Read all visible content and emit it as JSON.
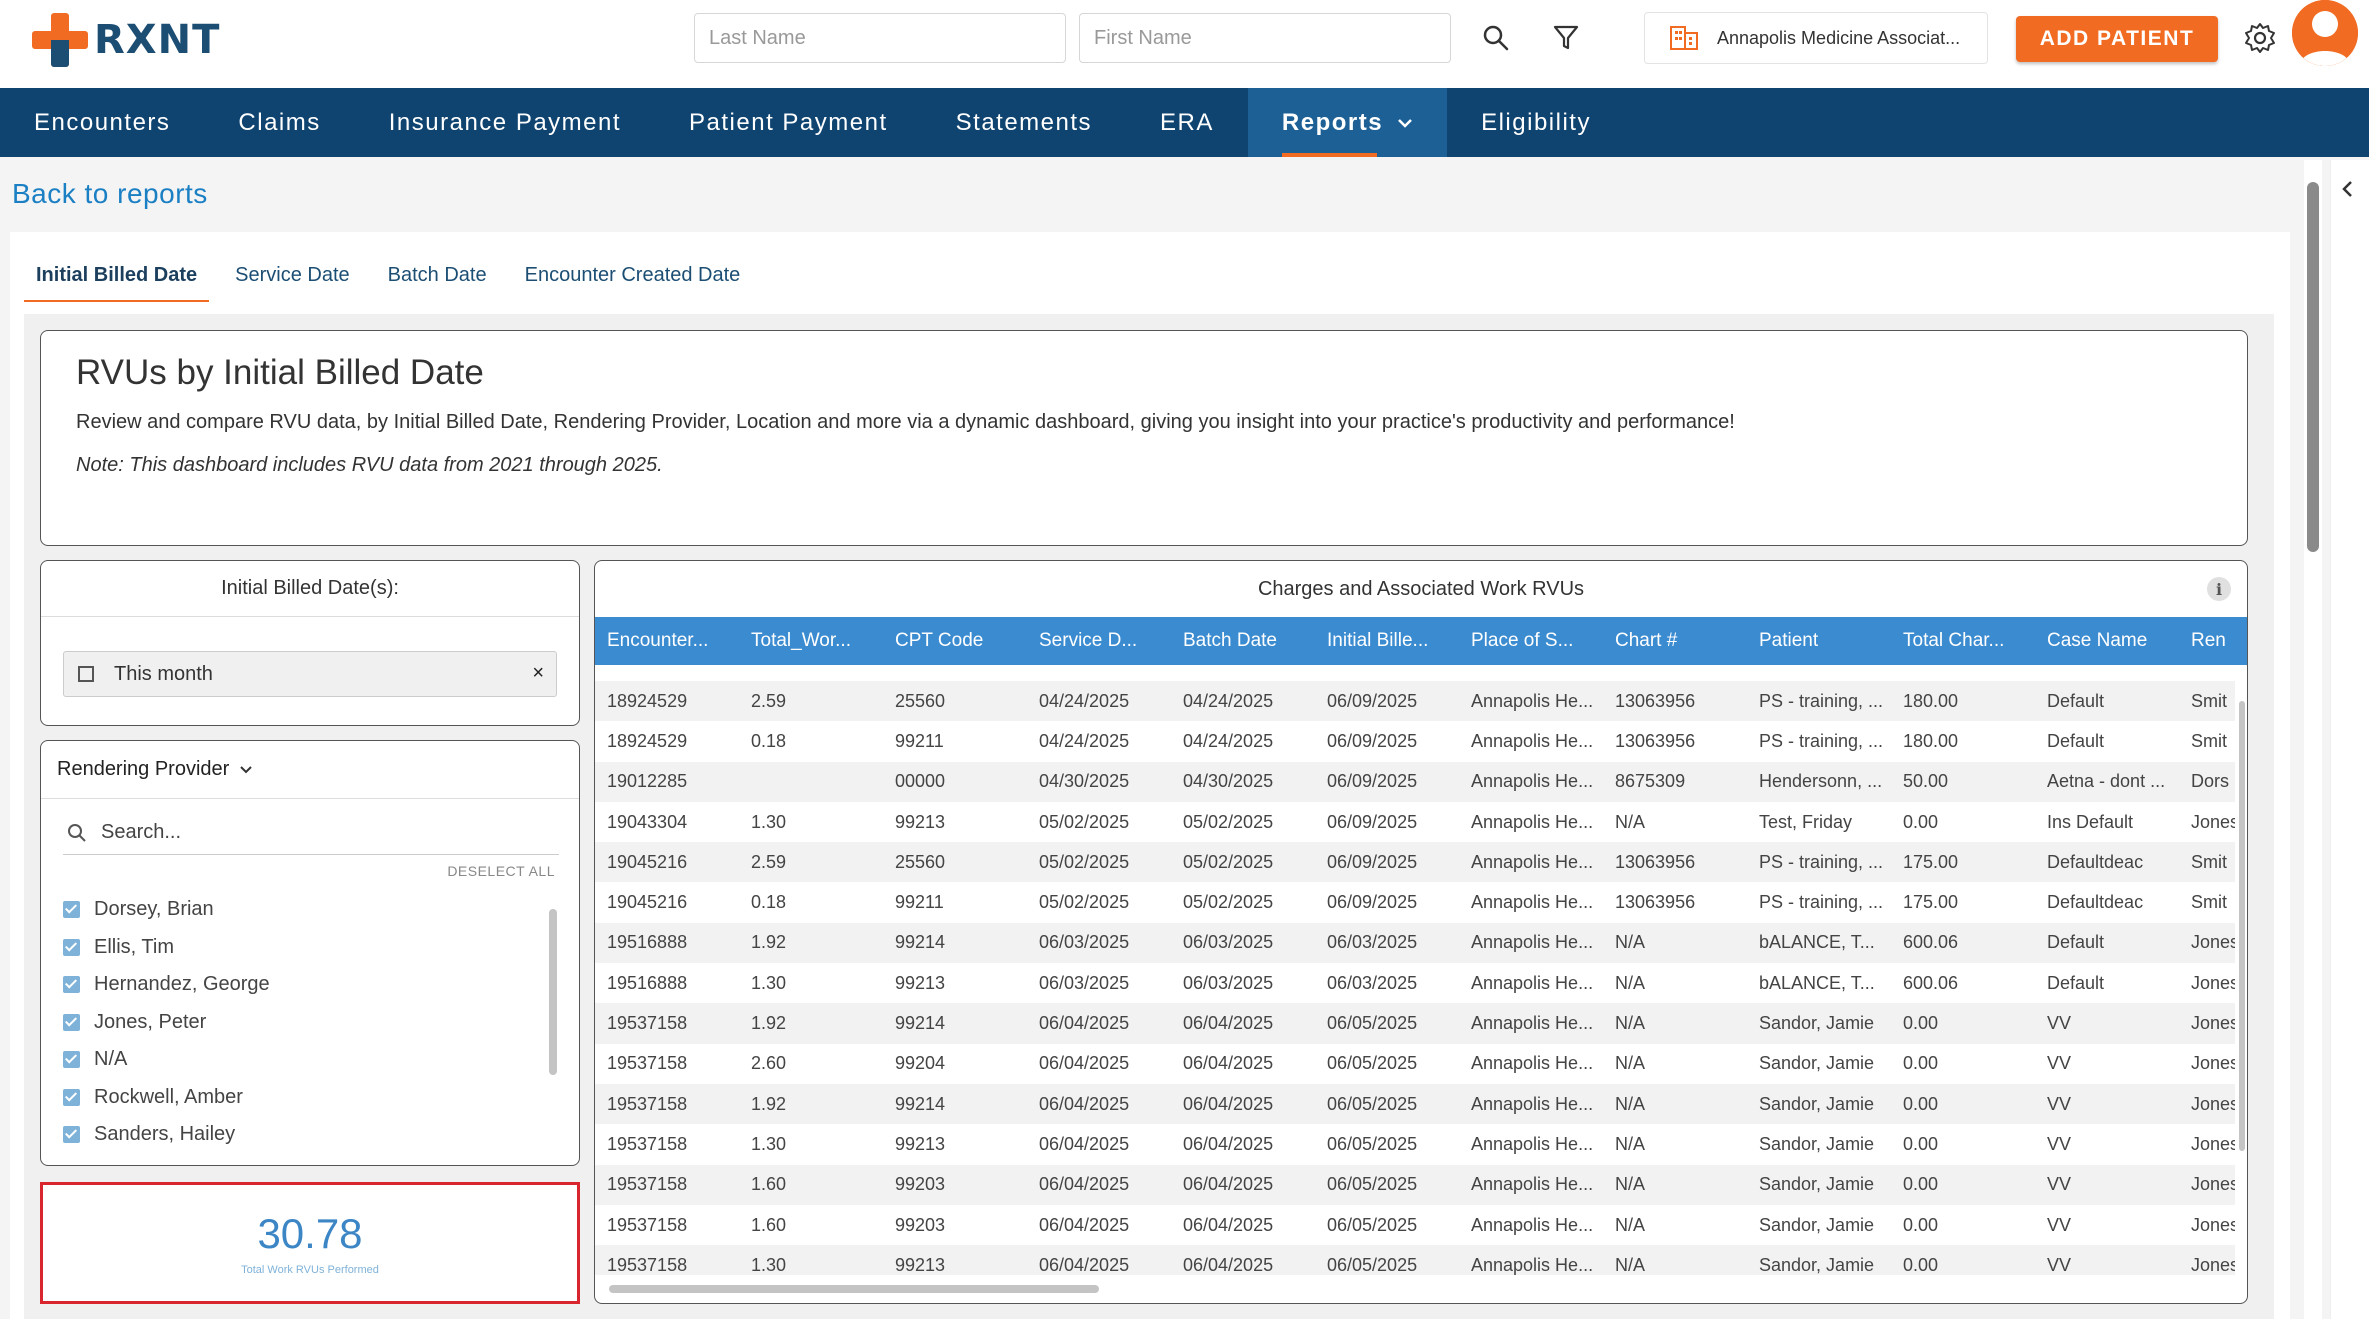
{
  "app": {
    "logo_text": "RXNT",
    "last_name_placeholder": "Last Name",
    "first_name_placeholder": "First Name",
    "practice_name": "Annapolis Medicine Associat...",
    "add_patient_label": "ADD PATIENT"
  },
  "nav": {
    "items": [
      "Encounters",
      "Claims",
      "Insurance Payment",
      "Patient Payment",
      "Statements",
      "ERA",
      "Reports",
      "Eligibility"
    ],
    "active": "Reports"
  },
  "back_label": "Back to reports",
  "tabs": [
    "Initial Billed Date",
    "Service Date",
    "Batch Date",
    "Encounter Created Date"
  ],
  "header": {
    "title": "RVUs by Initial Billed Date",
    "description": "Review and compare RVU data, by Initial Billed Date, Rendering Provider, Location and more via a dynamic dashboard, giving you insight into your practice's productivity and performance!",
    "note": "Note: This dashboard includes RVU data from 2021 through 2025."
  },
  "date_filter": {
    "title": "Initial Billed Date(s):",
    "value": "This month",
    "clear": "×"
  },
  "provider_filter": {
    "title": "Rendering Provider",
    "search_placeholder": "Search...",
    "deselect_label": "DESELECT ALL",
    "providers": [
      "Dorsey, Brian",
      "Ellis, Tim",
      "Hernandez, George",
      "Jones, Peter",
      "N/A",
      "Rockwell, Amber",
      "Sanders, Hailey"
    ]
  },
  "kpi": {
    "value": "30.78",
    "label": "Total Work RVUs Performed"
  },
  "table": {
    "title": "Charges and Associated Work RVUs",
    "info": "i",
    "columns": [
      "Encounter...",
      "Total_Wor...",
      "CPT Code",
      "Service D...",
      "Batch Date",
      "Initial Bille...",
      "Place of S...",
      "Chart #",
      "Patient",
      "Total Char...",
      "Case Name",
      "Ren"
    ],
    "rows": [
      [
        "18924529",
        "2.59",
        "25560",
        "04/24/2025",
        "04/24/2025",
        "06/09/2025",
        "Annapolis He...",
        "13063956",
        "PS - training, ...",
        "180.00",
        "Default",
        "Smit"
      ],
      [
        "18924529",
        "0.18",
        "99211",
        "04/24/2025",
        "04/24/2025",
        "06/09/2025",
        "Annapolis He...",
        "13063956",
        "PS - training, ...",
        "180.00",
        "Default",
        "Smit"
      ],
      [
        "19012285",
        "",
        "00000",
        "04/30/2025",
        "04/30/2025",
        "06/09/2025",
        "Annapolis He...",
        "8675309",
        "Hendersonn, ...",
        "50.00",
        "Aetna - dont ...",
        "Dors"
      ],
      [
        "19043304",
        "1.30",
        "99213",
        "05/02/2025",
        "05/02/2025",
        "06/09/2025",
        "Annapolis He...",
        "N/A",
        "Test, Friday",
        "0.00",
        "Ins Default",
        "Jones"
      ],
      [
        "19045216",
        "2.59",
        "25560",
        "05/02/2025",
        "05/02/2025",
        "06/09/2025",
        "Annapolis He...",
        "13063956",
        "PS - training, ...",
        "175.00",
        "Defaultdeac",
        "Smit"
      ],
      [
        "19045216",
        "0.18",
        "99211",
        "05/02/2025",
        "05/02/2025",
        "06/09/2025",
        "Annapolis He...",
        "13063956",
        "PS - training, ...",
        "175.00",
        "Defaultdeac",
        "Smit"
      ],
      [
        "19516888",
        "1.92",
        "99214",
        "06/03/2025",
        "06/03/2025",
        "06/03/2025",
        "Annapolis He...",
        "N/A",
        "bALANCE, T...",
        "600.06",
        "Default",
        "Jones"
      ],
      [
        "19516888",
        "1.30",
        "99213",
        "06/03/2025",
        "06/03/2025",
        "06/03/2025",
        "Annapolis He...",
        "N/A",
        "bALANCE, T...",
        "600.06",
        "Default",
        "Jones"
      ],
      [
        "19537158",
        "1.92",
        "99214",
        "06/04/2025",
        "06/04/2025",
        "06/05/2025",
        "Annapolis He...",
        "N/A",
        "Sandor, Jamie",
        "0.00",
        "VV",
        "Jones"
      ],
      [
        "19537158",
        "2.60",
        "99204",
        "06/04/2025",
        "06/04/2025",
        "06/05/2025",
        "Annapolis He...",
        "N/A",
        "Sandor, Jamie",
        "0.00",
        "VV",
        "Jones"
      ],
      [
        "19537158",
        "1.92",
        "99214",
        "06/04/2025",
        "06/04/2025",
        "06/05/2025",
        "Annapolis He...",
        "N/A",
        "Sandor, Jamie",
        "0.00",
        "VV",
        "Jones"
      ],
      [
        "19537158",
        "1.30",
        "99213",
        "06/04/2025",
        "06/04/2025",
        "06/05/2025",
        "Annapolis He...",
        "N/A",
        "Sandor, Jamie",
        "0.00",
        "VV",
        "Jones"
      ],
      [
        "19537158",
        "1.60",
        "99203",
        "06/04/2025",
        "06/04/2025",
        "06/05/2025",
        "Annapolis He...",
        "N/A",
        "Sandor, Jamie",
        "0.00",
        "VV",
        "Jones"
      ],
      [
        "19537158",
        "1.60",
        "99203",
        "06/04/2025",
        "06/04/2025",
        "06/05/2025",
        "Annapolis He...",
        "N/A",
        "Sandor, Jamie",
        "0.00",
        "VV",
        "Jones"
      ],
      [
        "19537158",
        "1.30",
        "99213",
        "06/04/2025",
        "06/04/2025",
        "06/05/2025",
        "Annapolis He...",
        "N/A",
        "Sandor, Jamie",
        "0.00",
        "VV",
        "Jones"
      ]
    ]
  },
  "colors": {
    "brand_orange": "#f26b22",
    "brand_navy": "#0f4470",
    "table_header": "#3b8bd0",
    "kpi_highlight": "#d9252e"
  },
  "icons": [
    "search-icon",
    "filter-icon",
    "building-icon",
    "gear-icon",
    "chevron-down-icon",
    "calendar-icon",
    "info-icon",
    "check-icon"
  ]
}
